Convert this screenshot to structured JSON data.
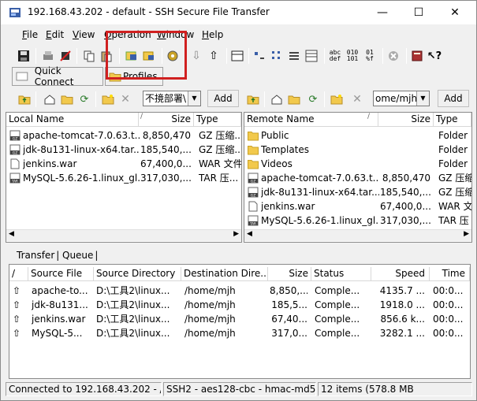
{
  "window": {
    "title": "192.168.43.202 - default - SSH Secure File Transfer",
    "minimize": "—",
    "maximize": "☐",
    "close": "✕"
  },
  "menu": [
    {
      "label": "File",
      "key": "F",
      "rest": "ile"
    },
    {
      "label": "Edit",
      "key": "E",
      "rest": "dit"
    },
    {
      "label": "View",
      "key": "V",
      "rest": "iew"
    },
    {
      "label": "Operation",
      "key": "O",
      "rest": "peration"
    },
    {
      "label": "Window",
      "key": "W",
      "rest": "indow"
    },
    {
      "label": "Help",
      "key": "H",
      "rest": "elp"
    }
  ],
  "toolbar2": {
    "quick_connect": "Quick Connect",
    "profiles": "Profiles"
  },
  "local": {
    "path": "不摬部署\\",
    "add": "Add",
    "headers": {
      "name": "Local Name",
      "size": "Size",
      "type": "Type"
    },
    "files": [
      {
        "name": "apache-tomcat-7.0.63.t...",
        "size": "8,850,470",
        "type": "GZ 压缩...",
        "icon": "gz"
      },
      {
        "name": "jdk-8u131-linux-x64.tar....",
        "size": "185,540,...",
        "type": "GZ 压缩...",
        "icon": "gz"
      },
      {
        "name": "jenkins.war",
        "size": "67,400,0...",
        "type": "WAR 文件",
        "icon": "file"
      },
      {
        "name": "MySQL-5.6.26-1.linux_gl...",
        "size": "317,030,...",
        "type": "TAR 压...",
        "icon": "tar"
      }
    ]
  },
  "remote": {
    "path": "ome/mjh",
    "add": "Add",
    "headers": {
      "name": "Remote Name",
      "size": "Size",
      "type": "Type"
    },
    "files": [
      {
        "name": "Public",
        "size": "",
        "type": "Folder",
        "icon": "folder"
      },
      {
        "name": "Templates",
        "size": "",
        "type": "Folder",
        "icon": "folder"
      },
      {
        "name": "Videos",
        "size": "",
        "type": "Folder",
        "icon": "folder"
      },
      {
        "name": "apache-tomcat-7.0.63.t...",
        "size": "8,850,470",
        "type": "GZ 压缩",
        "icon": "gz"
      },
      {
        "name": "jdk-8u131-linux-x64.tar....",
        "size": "185,540,...",
        "type": "GZ 压缩",
        "icon": "gz"
      },
      {
        "name": "jenkins.war",
        "size": "67,400,0...",
        "type": "WAR 文件",
        "icon": "file"
      },
      {
        "name": "MySQL-5.6.26-1.linux_gl...",
        "size": "317,030,...",
        "type": "TAR 压",
        "icon": "tar"
      }
    ]
  },
  "tabs": {
    "transfer": "Transfer",
    "queue": "Queue"
  },
  "transfer": {
    "headers": {
      "dir": "/",
      "file": "Source File",
      "srcdir": "Source Directory",
      "dest": "Destination Dire...",
      "size": "Size",
      "status": "Status",
      "speed": "Speed",
      "time": "Time"
    },
    "rows": [
      {
        "arrow": "⇧",
        "file": "apache-to...",
        "srcdir": "D:\\工具2\\linux...",
        "dest": "/home/mjh",
        "size": "8,850,...",
        "status": "Comple...",
        "speed": "4135.7 ...",
        "time": "00:0..."
      },
      {
        "arrow": "⇧",
        "file": "jdk-8u131...",
        "srcdir": "D:\\工具2\\linux...",
        "dest": "/home/mjh",
        "size": "185,5...",
        "status": "Comple...",
        "speed": "1918.0 ...",
        "time": "00:0..."
      },
      {
        "arrow": "⇧",
        "file": "jenkins.war",
        "srcdir": "D:\\工具2\\linux...",
        "dest": "/home/mjh",
        "size": "67,40...",
        "status": "Comple...",
        "speed": "856.6 k...",
        "time": "00:0..."
      },
      {
        "arrow": "⇧",
        "file": "MySQL-5...",
        "srcdir": "D:\\工具2\\linux...",
        "dest": "/home/mjh",
        "size": "317,0...",
        "status": "Comple...",
        "speed": "3282.1 ...",
        "time": "00:0..."
      }
    ]
  },
  "status": {
    "connected": "Connected to 192.168.43.202 - /h",
    "cipher": "SSH2 - aes128-cbc - hmac-md5",
    "items": "12 items (578.8 MB"
  },
  "colors": {
    "highlight": "#d02020",
    "folder": "#f2c94c",
    "window_bg": "#f0f0f0"
  }
}
